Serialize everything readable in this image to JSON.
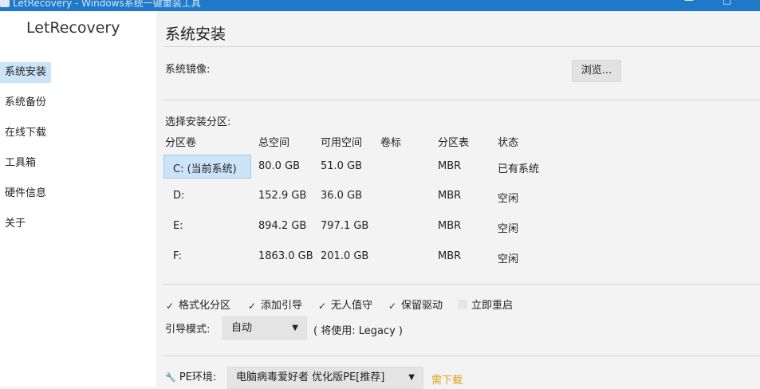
{
  "window": {
    "title": "LetRecovery - Windows系统一键重装工具"
  },
  "sidebar": {
    "brand": "LetRecovery",
    "items": [
      {
        "label": "系统安装",
        "active": true
      },
      {
        "label": "系统备份",
        "active": false
      },
      {
        "label": "在线下载",
        "active": false
      },
      {
        "label": "工具箱",
        "active": false
      },
      {
        "label": "硬件信息",
        "active": false
      },
      {
        "label": "关于",
        "active": false
      }
    ]
  },
  "main": {
    "title": "系统安装",
    "image_label": "系统镜像:",
    "browse_button": "浏览...",
    "partition_section_label": "选择安装分区:",
    "table": {
      "headers": [
        "分区卷",
        "总空间",
        "可用空间",
        "卷标",
        "分区表",
        "状态"
      ],
      "rows": [
        {
          "volume": "C: (当前系统)",
          "total": "80.0 GB",
          "free": "51.0 GB",
          "label": "",
          "table": "MBR",
          "status": "已有系统",
          "selected": true
        },
        {
          "volume": "D:",
          "total": "152.9 GB",
          "free": "36.0 GB",
          "label": "",
          "table": "MBR",
          "status": "空闲",
          "selected": false
        },
        {
          "volume": "E:",
          "total": "894.2 GB",
          "free": "797.1 GB",
          "label": "",
          "table": "MBR",
          "status": "空闲",
          "selected": false
        },
        {
          "volume": "F:",
          "total": "1863.0 GB",
          "free": "201.0 GB",
          "label": "",
          "table": "MBR",
          "status": "空闲",
          "selected": false
        }
      ]
    },
    "options": [
      {
        "label": "格式化分区",
        "checked": true
      },
      {
        "label": "添加引导",
        "checked": true
      },
      {
        "label": "无人值守",
        "checked": true
      },
      {
        "label": "保留驱动",
        "checked": true
      },
      {
        "label": "立即重启",
        "checked": false
      }
    ],
    "boot_mode": {
      "label": "引导模式:",
      "value": "自动",
      "note": "( 将使用: Legacy )"
    },
    "pe": {
      "label": "PE环境:",
      "value": "电脑病毒爱好者 优化版PE[推荐]",
      "download_hint": "需下载",
      "hint_color": "#e0a11b"
    }
  }
}
